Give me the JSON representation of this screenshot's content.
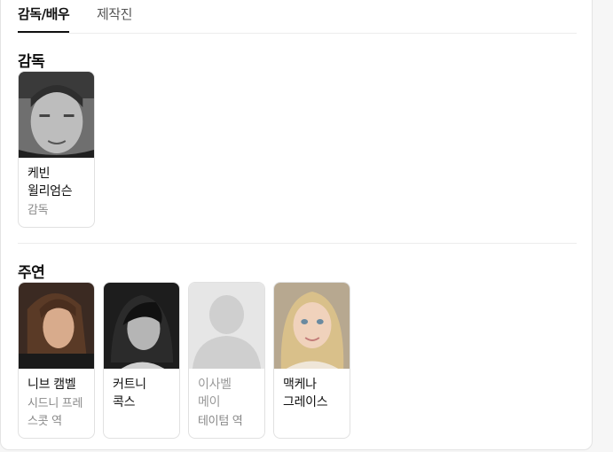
{
  "tabs": [
    {
      "label": "감독/배우",
      "active": true
    },
    {
      "label": "제작진",
      "active": false
    }
  ],
  "sections": {
    "director": {
      "title": "감독",
      "people": [
        {
          "name": "케빈 윌리엄슨",
          "role": "감독"
        }
      ]
    },
    "cast": {
      "title": "주연",
      "people": [
        {
          "name": "니브 캠벨",
          "role": "시드니 프레스콧 역"
        },
        {
          "name": "커트니 콕스",
          "role": ""
        },
        {
          "name": "이사벨 메이",
          "role": "테이텀 역"
        },
        {
          "name": "맥케나 그레이스",
          "role": ""
        }
      ]
    }
  },
  "colors": {
    "active_tab": "#111111",
    "inactive_tab": "#555555",
    "placeholder_bg": "#e6e6e6",
    "placeholder_silhouette": "#cfcfcf"
  }
}
